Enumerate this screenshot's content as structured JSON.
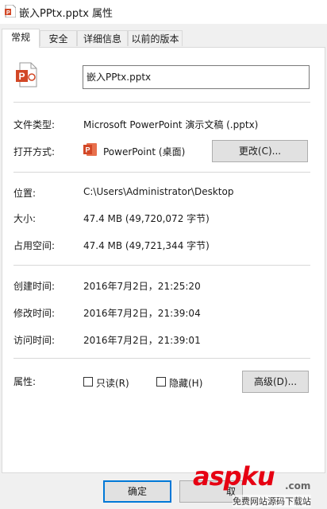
{
  "window": {
    "title": "嵌入PPtx.pptx 属性",
    "icon": "powerpoint-file-icon"
  },
  "tabs": [
    {
      "label": "常规",
      "active": true
    },
    {
      "label": "安全",
      "active": false
    },
    {
      "label": "详细信息",
      "active": false
    },
    {
      "label": "以前的版本",
      "active": false
    }
  ],
  "general": {
    "file_icon": "powerpoint-file-icon",
    "file_name": "嵌入PPtx.pptx",
    "file_type_label": "文件类型:",
    "file_type_value": "Microsoft PowerPoint 演示文稿 (.pptx)",
    "open_with_label": "打开方式:",
    "open_with_app": "PowerPoint (桌面)",
    "open_with_icon": "powerpoint-app-icon",
    "change_button": "更改(C)...",
    "location_label": "位置:",
    "location_value": "C:\\Users\\Administrator\\Desktop",
    "size_label": "大小:",
    "size_value": "47.4 MB (49,720,072 字节)",
    "size_on_disk_label": "占用空间:",
    "size_on_disk_value": "47.4 MB (49,721,344 字节)",
    "created_label": "创建时间:",
    "created_value": "2016年7月2日，21:25:20",
    "modified_label": "修改时间:",
    "modified_value": "2016年7月2日，21:39:04",
    "accessed_label": "访问时间:",
    "accessed_value": "2016年7月2日，21:39:01",
    "attributes_label": "属性:",
    "readonly_label": "只读(R)",
    "readonly_checked": false,
    "hidden_label": "隐藏(H)",
    "hidden_checked": false,
    "advanced_button": "高级(D)..."
  },
  "footer": {
    "ok": "确定",
    "cancel": "取"
  },
  "watermark": {
    "brand": "aspku",
    "suffix": ".com",
    "tagline": "免费网站源码下载站"
  },
  "colors": {
    "powerpoint": "#d24726",
    "watermark_red": "#e60012"
  }
}
